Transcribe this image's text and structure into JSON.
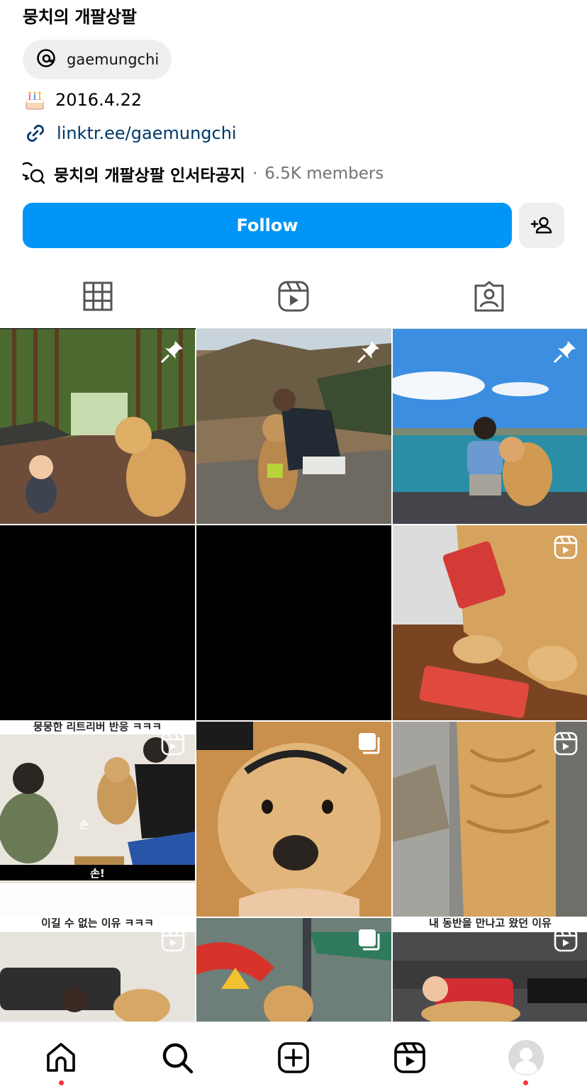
{
  "profile": {
    "display_name": "뭉치의 개팔상팔",
    "threads_handle": "gaemungchi",
    "birthday_emoji": "🎂",
    "birthday": "2016.4.22",
    "link": "linktr.ee/gaemungchi",
    "channel_name": "뭉치의 개팔상팔 인서타공지",
    "channel_separator": "·",
    "channel_members": "6.5K members"
  },
  "actions": {
    "follow_label": "Follow"
  },
  "tabs": [
    {
      "name": "posts",
      "icon": "grid-icon",
      "active": true
    },
    {
      "name": "reels",
      "icon": "reels-icon",
      "active": false
    },
    {
      "name": "tagged",
      "icon": "tagged-icon",
      "active": false
    }
  ],
  "grid": {
    "tiles": [
      {
        "badge": "pin-icon",
        "scene": "forest path with toddler and golden retriever"
      },
      {
        "badge": "pin-icon",
        "scene": "man hugging golden retriever on hillside"
      },
      {
        "badge": "pin-icon",
        "scene": "man and golden retriever by the sea"
      },
      {
        "badge": "",
        "scene": "black"
      },
      {
        "badge": "",
        "scene": "black"
      },
      {
        "badge": "reel-icon",
        "scene": "golden retriever with snack packs"
      },
      {
        "badge": "reel-icon",
        "scene": "couple giving paw to dog",
        "caption_top": "뭉뭉한 리트리버 반응 ㅋㅋㅋ",
        "subtitle": "손!",
        "mid_label": "손"
      },
      {
        "badge": "carousel-icon",
        "scene": "golden retriever face close-up with ribbon"
      },
      {
        "badge": "reel-icon",
        "scene": "golden retriever walking on stone path"
      },
      {
        "badge": "reel-icon",
        "scene": "man on sofa with dog",
        "caption_top": "이길 수 없는 이유 ㅋㅋㅋ"
      },
      {
        "badge": "carousel-icon",
        "scene": "dog at water park with red slide"
      },
      {
        "badge": "reel-icon",
        "scene": "man in red shirt lying with dog",
        "caption_top": "내 동반을 만나고 왔던 이유"
      }
    ]
  },
  "bottom_nav": [
    {
      "name": "home",
      "icon": "home-icon",
      "dot": true
    },
    {
      "name": "search",
      "icon": "search-icon",
      "dot": false
    },
    {
      "name": "create",
      "icon": "create-icon",
      "dot": false
    },
    {
      "name": "reels",
      "icon": "reels-icon",
      "dot": false
    },
    {
      "name": "profile",
      "icon": "avatar-icon",
      "dot": true
    }
  ],
  "colors": {
    "follow_blue": "#0095f6",
    "link_blue": "#00376b",
    "muted_gray": "#737373",
    "notification_red": "#ff3040"
  }
}
